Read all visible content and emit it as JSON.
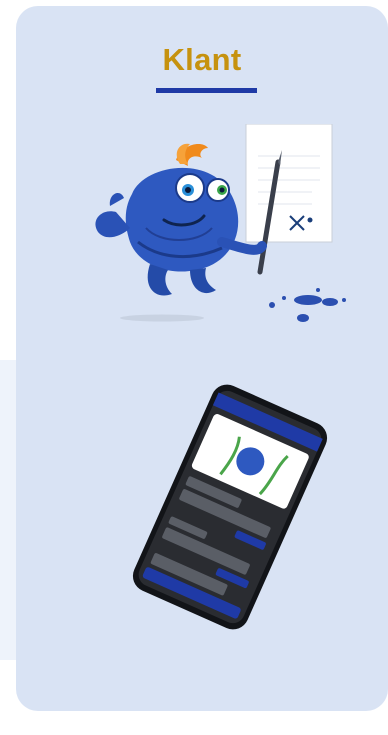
{
  "card": {
    "title": "Klant"
  },
  "mascot": {
    "icon": "fish-mascot-signing-document-icon"
  },
  "phone": {
    "icon": "smartphone-app-preview-icon",
    "accent": "#1f3aa6"
  },
  "colors": {
    "card_bg": "#d9e3f4",
    "title": "#c6920f",
    "underline": "#1f3aa6"
  }
}
